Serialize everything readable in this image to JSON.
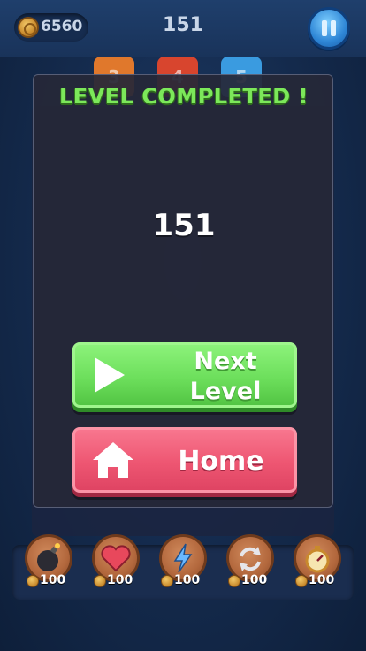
{
  "header": {
    "coins": "6560",
    "level": "151",
    "pause_icon": "pause-icon"
  },
  "background_tiles": [
    {
      "value": "3",
      "color": "#e0782c"
    },
    {
      "value": "4",
      "color": "#d8452e"
    },
    {
      "value": "5",
      "color": "#3a9be0"
    }
  ],
  "dialog": {
    "title": "LEVEL COMPLETED !",
    "score": "151",
    "next_button": {
      "line1": "Next",
      "line2": "Level",
      "icon": "play-icon"
    },
    "home_button": {
      "label": "Home",
      "icon": "home-icon"
    }
  },
  "powerups": [
    {
      "icon": "bomb-icon",
      "price": "100"
    },
    {
      "icon": "heart-icon",
      "price": "100"
    },
    {
      "icon": "lightning-icon",
      "price": "100"
    },
    {
      "icon": "refresh-icon",
      "price": "100"
    },
    {
      "icon": "stopwatch-icon",
      "price": "100"
    }
  ],
  "colors": {
    "title_green": "#7ce85a",
    "next_green": "#6ddf5c",
    "home_pink": "#ee5672",
    "pause_blue": "#2e86d6"
  }
}
